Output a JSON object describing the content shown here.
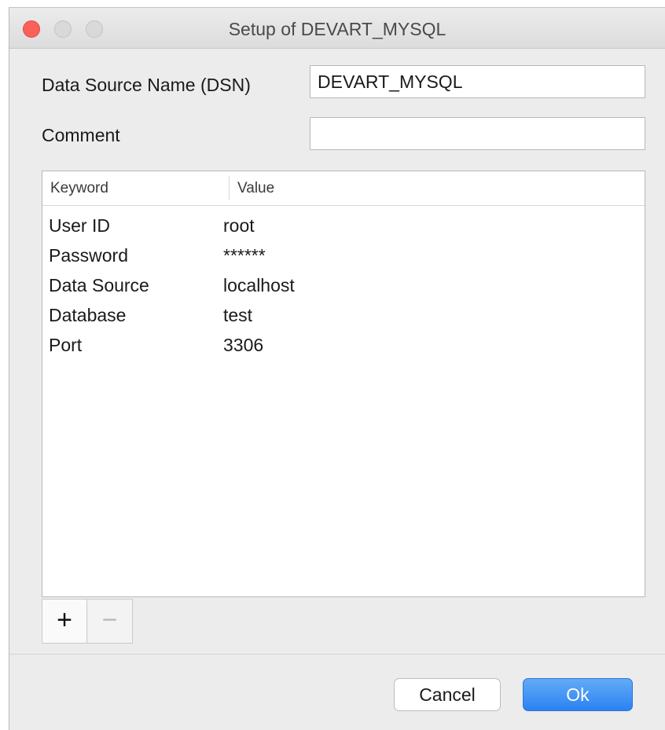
{
  "window": {
    "title": "Setup of DEVART_MYSQL"
  },
  "form": {
    "dsn_label": "Data Source Name (DSN)",
    "dsn_value": "DEVART_MYSQL",
    "comment_label": "Comment",
    "comment_value": ""
  },
  "table": {
    "columns": [
      "Keyword",
      "Value"
    ],
    "rows": [
      {
        "keyword": "User ID",
        "value": "root"
      },
      {
        "keyword": "Password",
        "value": "******"
      },
      {
        "keyword": "Data Source",
        "value": "localhost"
      },
      {
        "keyword": "Database",
        "value": "test"
      },
      {
        "keyword": "Port",
        "value": "3306"
      }
    ]
  },
  "toolbar": {
    "add_label": "+",
    "remove_label": "−"
  },
  "buttons": {
    "cancel": "Cancel",
    "ok": "Ok"
  },
  "colors": {
    "close": "#fc605b",
    "accent": "#2a83f2"
  }
}
